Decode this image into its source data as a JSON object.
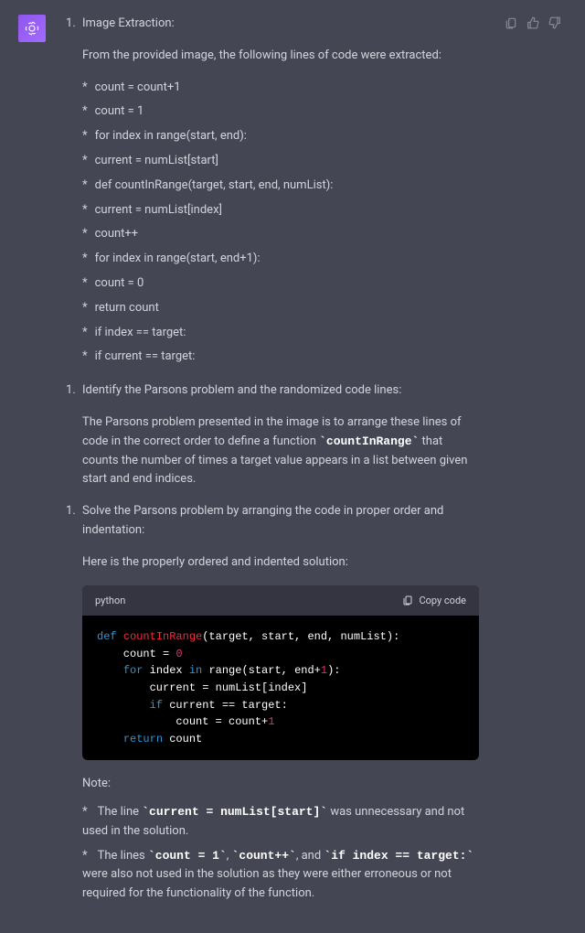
{
  "section1": {
    "title": "Image Extraction:"
  },
  "intro": "From the provided image, the following lines of code were extracted:",
  "extracted": [
    "count = count+1",
    "count = 1",
    "for index in range(start, end):",
    "current = numList[start]",
    "def countInRange(target, start, end, numList):",
    "current = numList[index]",
    "count++",
    "for index in range(start, end+1):",
    "count = 0",
    "return count",
    "if index == target:",
    "if current == target:"
  ],
  "section2": {
    "title": "Identify the Parsons problem and the randomized code lines:"
  },
  "parsons_desc_pre": "The Parsons problem presented in the image is to arrange these lines of code in the correct order to define a function ",
  "parsons_fn": "`countInRange`",
  "parsons_desc_post": " that counts the number of times a target value appears in a list between given start and end indices.",
  "section3": {
    "title": "Solve the Parsons problem by arranging the code in proper order and indentation:"
  },
  "solution_intro": "Here is the properly ordered and indented solution:",
  "code": {
    "lang": "python",
    "copy_label": "Copy code",
    "lines": {
      "l1_def": "def",
      "l1_fn": "countInRange",
      "l1_rest": "(target, start, end, numList):",
      "l2_pre": "    count = ",
      "l2_num": "0",
      "l3_for": "for",
      "l3_mid": " index ",
      "l3_in": "in",
      "l3_mid2": " range(start, end+",
      "l3_num": "1",
      "l3_end": "):",
      "l4": "        current = numList[index]",
      "l5_if": "if",
      "l5_rest": " current == target:",
      "l6_pre": "            count = count+",
      "l6_num": "1",
      "l7_ret": "return",
      "l7_rest": " count"
    }
  },
  "note_label": "Note:",
  "notes": {
    "n1_pre": "The line ",
    "n1_code": "`current = numList[start]`",
    "n1_post": " was unnecessary and not used in the solution.",
    "n2_pre": "The lines ",
    "n2_c1": "`count = 1`",
    "n2_s1": ", ",
    "n2_c2": "`count++`",
    "n2_s2": ", and ",
    "n2_c3": "`if index == target:`",
    "n2_post": " were also not used in the solution as they were either erroneous or not required for the functionality of the function."
  }
}
